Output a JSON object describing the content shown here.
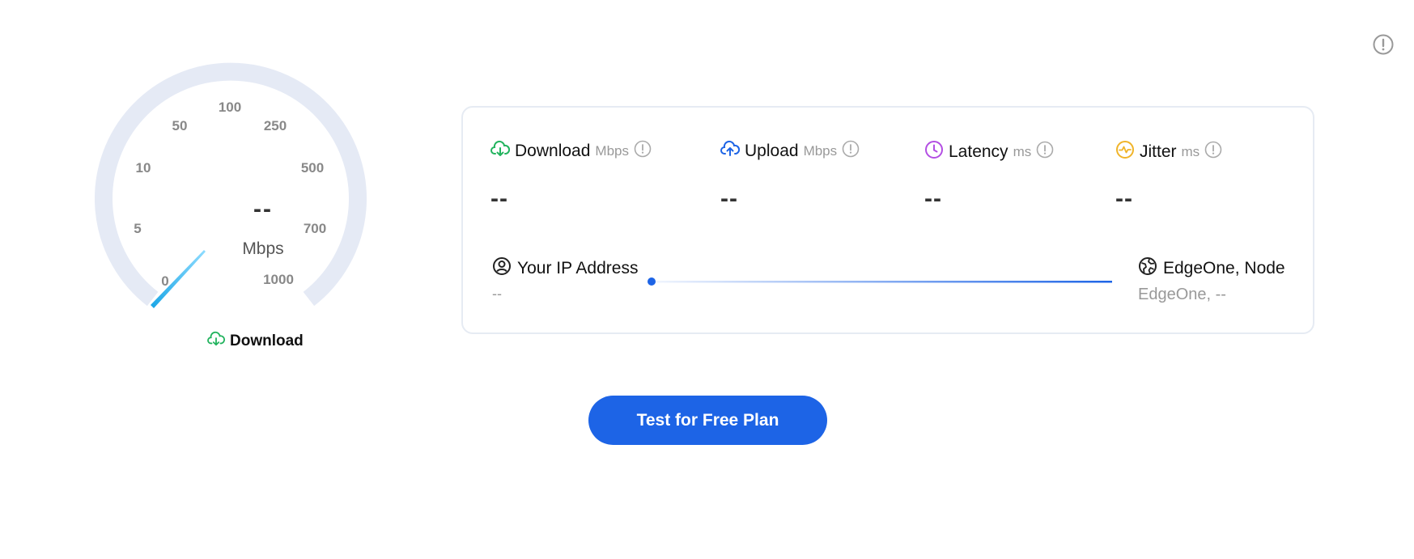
{
  "gauge": {
    "tick_labels": [
      "0",
      "5",
      "10",
      "50",
      "100",
      "250",
      "500",
      "700",
      "1000"
    ],
    "value": "--",
    "unit": "Mbps",
    "caption": "Download",
    "needle_fraction": 0.0
  },
  "metrics": [
    {
      "label": "Download",
      "unit": "Mbps",
      "value": "--",
      "icon": "cloud-download-icon",
      "color": "#22b35e"
    },
    {
      "label": "Upload",
      "unit": "Mbps",
      "value": "--",
      "icon": "cloud-upload-icon",
      "color": "#1d64e6"
    },
    {
      "label": "Latency",
      "unit": "ms",
      "value": "--",
      "icon": "clock-icon",
      "color": "#b34ee3"
    },
    {
      "label": "Jitter",
      "unit": "ms",
      "value": "--",
      "icon": "pulse-icon",
      "color": "#f0b429"
    }
  ],
  "connection": {
    "ip_title": "Your IP Address",
    "ip_value": "--",
    "node_title": "EdgeOne, Node",
    "node_value": "EdgeOne, --"
  },
  "actions": {
    "test_button": "Test for Free Plan"
  },
  "colors": {
    "accent": "#1d64e6",
    "gauge_track": "#e5eaf5",
    "needle": "#29b7ef"
  }
}
